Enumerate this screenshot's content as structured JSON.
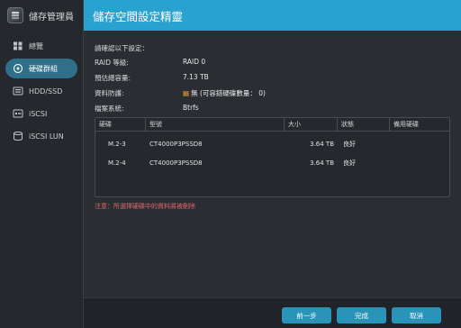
{
  "app": {
    "title": "儲存管理員"
  },
  "sidebar": {
    "items": [
      {
        "label": "總覽",
        "icon": "grid-icon"
      },
      {
        "label": "硬碟群組",
        "icon": "disk-group-icon",
        "active": true
      },
      {
        "label": "HDD/SSD",
        "icon": "drive-icon"
      },
      {
        "label": "iSCSI",
        "icon": "iscsi-icon"
      },
      {
        "label": "iSCSI LUN",
        "icon": "lun-icon"
      }
    ]
  },
  "dialog": {
    "title": "儲存空間設定精靈",
    "intro": "請確認以下設定：",
    "fields": {
      "raid_label": "RAID 等級:",
      "raid_value": "RAID 0",
      "capacity_label": "預估總容量:",
      "capacity_value": "7.13 TB",
      "protection_label": "資料防護:",
      "protection_icon": "warning-icon",
      "protection_value": "無 (可容錯硬碟數量： 0)",
      "fs_label": "檔案系統:",
      "fs_value": "Btrfs"
    },
    "table": {
      "headers": [
        "硬碟",
        "型號",
        "大小",
        "狀態",
        "備用硬碟"
      ],
      "rows": [
        [
          "M.2-3",
          "CT4000P3PSSD8",
          "3.64 TB",
          "良好",
          ""
        ],
        [
          "M.2-4",
          "CT4000P3PSSD8",
          "3.64 TB",
          "良好",
          ""
        ]
      ]
    },
    "note": "注意：所選擇硬碟中的資料將被刪除",
    "buttons": {
      "back": "前一步",
      "done": "完成",
      "cancel": "取消"
    }
  },
  "colors": {
    "accent": "#2aa2cf",
    "button": "#2a93b8",
    "warning": "#e06868",
    "sidebar_active": "#2f6f8a"
  }
}
